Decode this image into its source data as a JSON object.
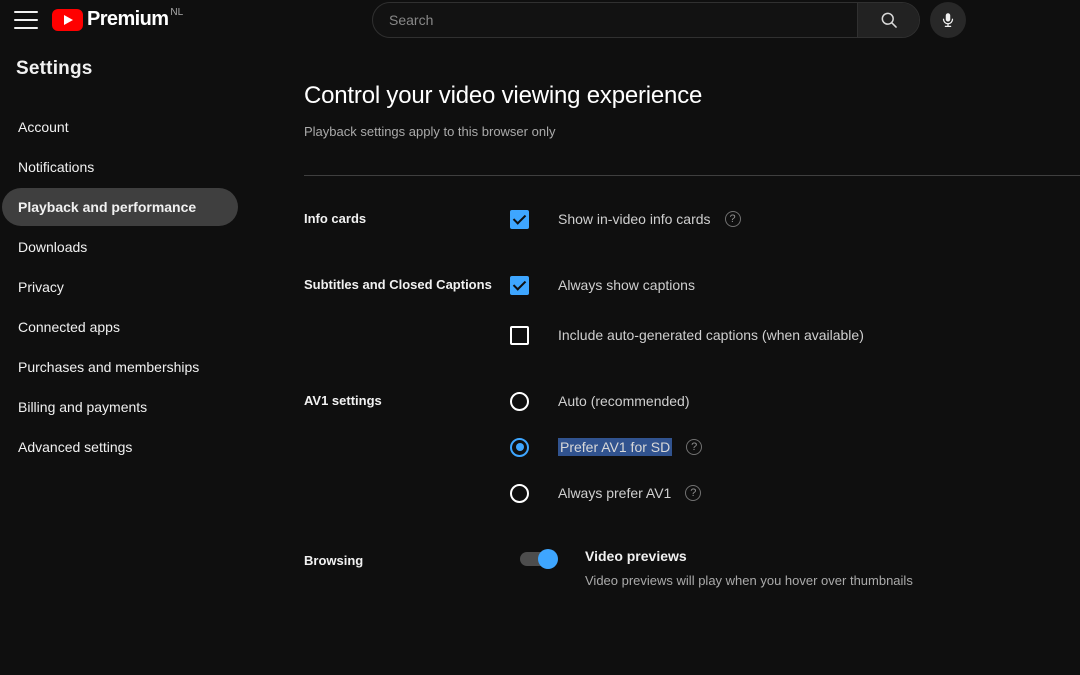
{
  "header": {
    "menu_icon": "hamburger-menu-icon",
    "logo_text": "Premium",
    "logo_superscript": "NL",
    "logo_icon": "youtube-play-icon",
    "search_placeholder": "Search",
    "search_value": "",
    "search_icon": "search-icon",
    "mic_icon": "microphone-icon"
  },
  "sidebar": {
    "title": "Settings",
    "items": [
      {
        "label": "Account",
        "active": false
      },
      {
        "label": "Notifications",
        "active": false
      },
      {
        "label": "Playback and performance",
        "active": true
      },
      {
        "label": "Downloads",
        "active": false
      },
      {
        "label": "Privacy",
        "active": false
      },
      {
        "label": "Connected apps",
        "active": false
      },
      {
        "label": "Purchases and memberships",
        "active": false
      },
      {
        "label": "Billing and payments",
        "active": false
      },
      {
        "label": "Advanced settings",
        "active": false
      }
    ]
  },
  "main": {
    "title": "Control your video viewing experience",
    "subtitle": "Playback settings apply to this browser only",
    "sections": {
      "info_cards": {
        "label": "Info cards",
        "option_label": "Show in-video info cards",
        "checked": true,
        "help_icon": "help-circle-icon"
      },
      "subtitles": {
        "label": "Subtitles and Closed Captions",
        "option1_label": "Always show captions",
        "option1_checked": true,
        "option2_label": "Include auto-generated captions (when available)",
        "option2_checked": false
      },
      "av1": {
        "label": "AV1 settings",
        "options": [
          {
            "label": "Auto (recommended)",
            "selected": false,
            "help": false,
            "text_highlighted": false
          },
          {
            "label": "Prefer AV1 for SD",
            "selected": true,
            "help": true,
            "text_highlighted": true
          },
          {
            "label": "Always prefer AV1",
            "selected": false,
            "help": true,
            "text_highlighted": false
          }
        ]
      },
      "browsing": {
        "label": "Browsing",
        "toggle_title": "Video previews",
        "toggle_desc": "Video previews will play when you hover over thumbnails",
        "toggle_on": true
      }
    }
  },
  "colors": {
    "background": "#0f0f0f",
    "accent_blue": "#3ea6ff",
    "brand_red": "#ff0000",
    "active_pill": "#3f3f3f",
    "text_selection": "#31538f"
  }
}
